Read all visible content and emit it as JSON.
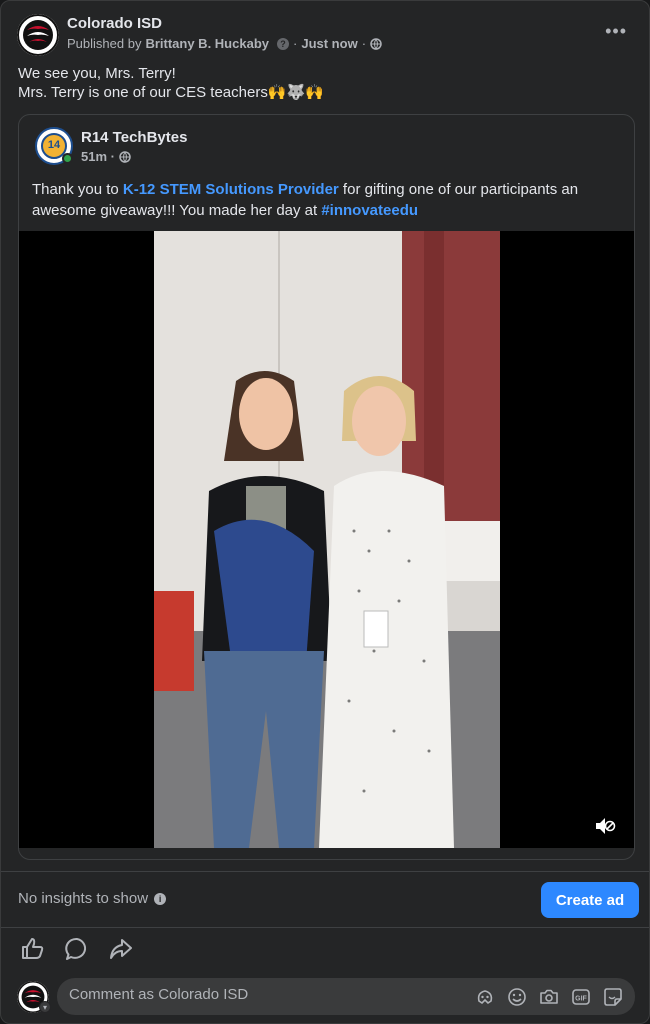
{
  "post": {
    "page_name": "Colorado ISD",
    "published_by_prefix": "Published by",
    "author": "Brittany B. Huckaby",
    "separator": "·",
    "time": "Just now",
    "text_line1": "We see you, Mrs. Terry!",
    "text_line2": "Mrs. Terry is one of our CES teachers🙌🐺🙌"
  },
  "shared": {
    "name": "R14 TechBytes",
    "time": "51m ·",
    "avatar_badge": "14",
    "text_start": "Thank you to ",
    "link_text": "K-12 STEM Solutions Provider",
    "text_middle": " for gifting one of our participants an awesome giveaway!!! You made her day at ",
    "hashtag": "#innovateedu"
  },
  "footer": {
    "insights": "No insights to show",
    "create_ad": "Create ad"
  },
  "comment": {
    "placeholder": "Comment as Colorado ISD"
  },
  "colors": {
    "background": "#242526",
    "accent": "#2d88ff",
    "link": "#4599ff",
    "online": "#31a24c"
  },
  "icons": [
    "more-options-icon",
    "help-icon",
    "globe-icon",
    "like-icon",
    "comment-icon",
    "share-icon",
    "avatar-sticker-icon",
    "emoji-icon",
    "camera-icon",
    "gif-icon",
    "sticker-icon",
    "mute-icon",
    "info-icon"
  ]
}
